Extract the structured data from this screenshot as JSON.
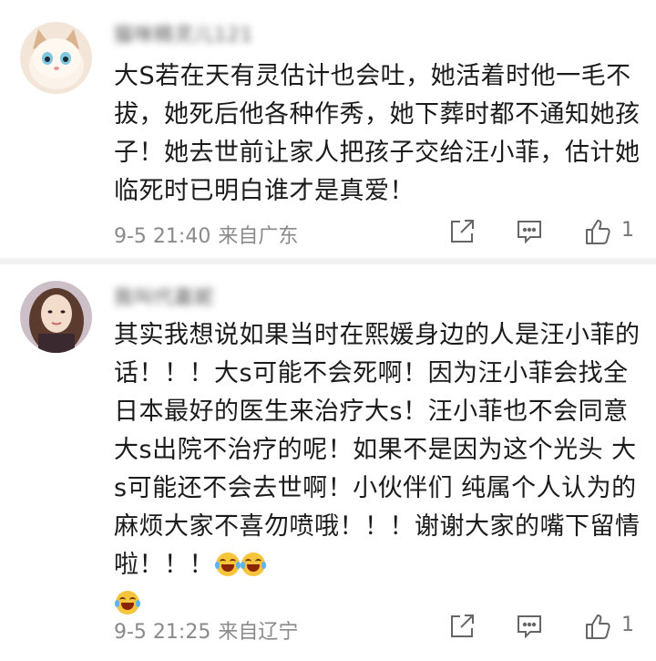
{
  "comments": [
    {
      "username": "猫咪精灵儿121",
      "text": "大S若在天有灵估计也会吐，她活着时他一毛不拔，她死后他各种作秀，她下葬时都不通知她孩子！她去世前让家人把孩子交给汪小菲，估计她临死时已明白谁才是真爱！",
      "time": "9-5 21:40",
      "location": "来自广东",
      "likes": "1"
    },
    {
      "username": "我叫代嘉妮",
      "text": "其实我想说如果当时在熙媛身边的人是汪小菲的话！！！大s可能不会死啊！因为汪小菲会找全日本最好的医生来治疗大s！汪小菲也不会同意大s出院不治疗的呢！如果不是因为这个光头 大s可能还不会去世啊！小伙伴们 纯属个人认为的 麻烦大家不喜勿喷哦！！！谢谢大家的嘴下留情啦！！！",
      "time": "9-5 21:25",
      "location": "来自辽宁",
      "likes": "1"
    }
  ],
  "icons": {
    "share": "share-icon",
    "comment": "comment-icon",
    "like": "thumbs-up-icon",
    "emoji": "laugh-cry-emoji-icon"
  }
}
